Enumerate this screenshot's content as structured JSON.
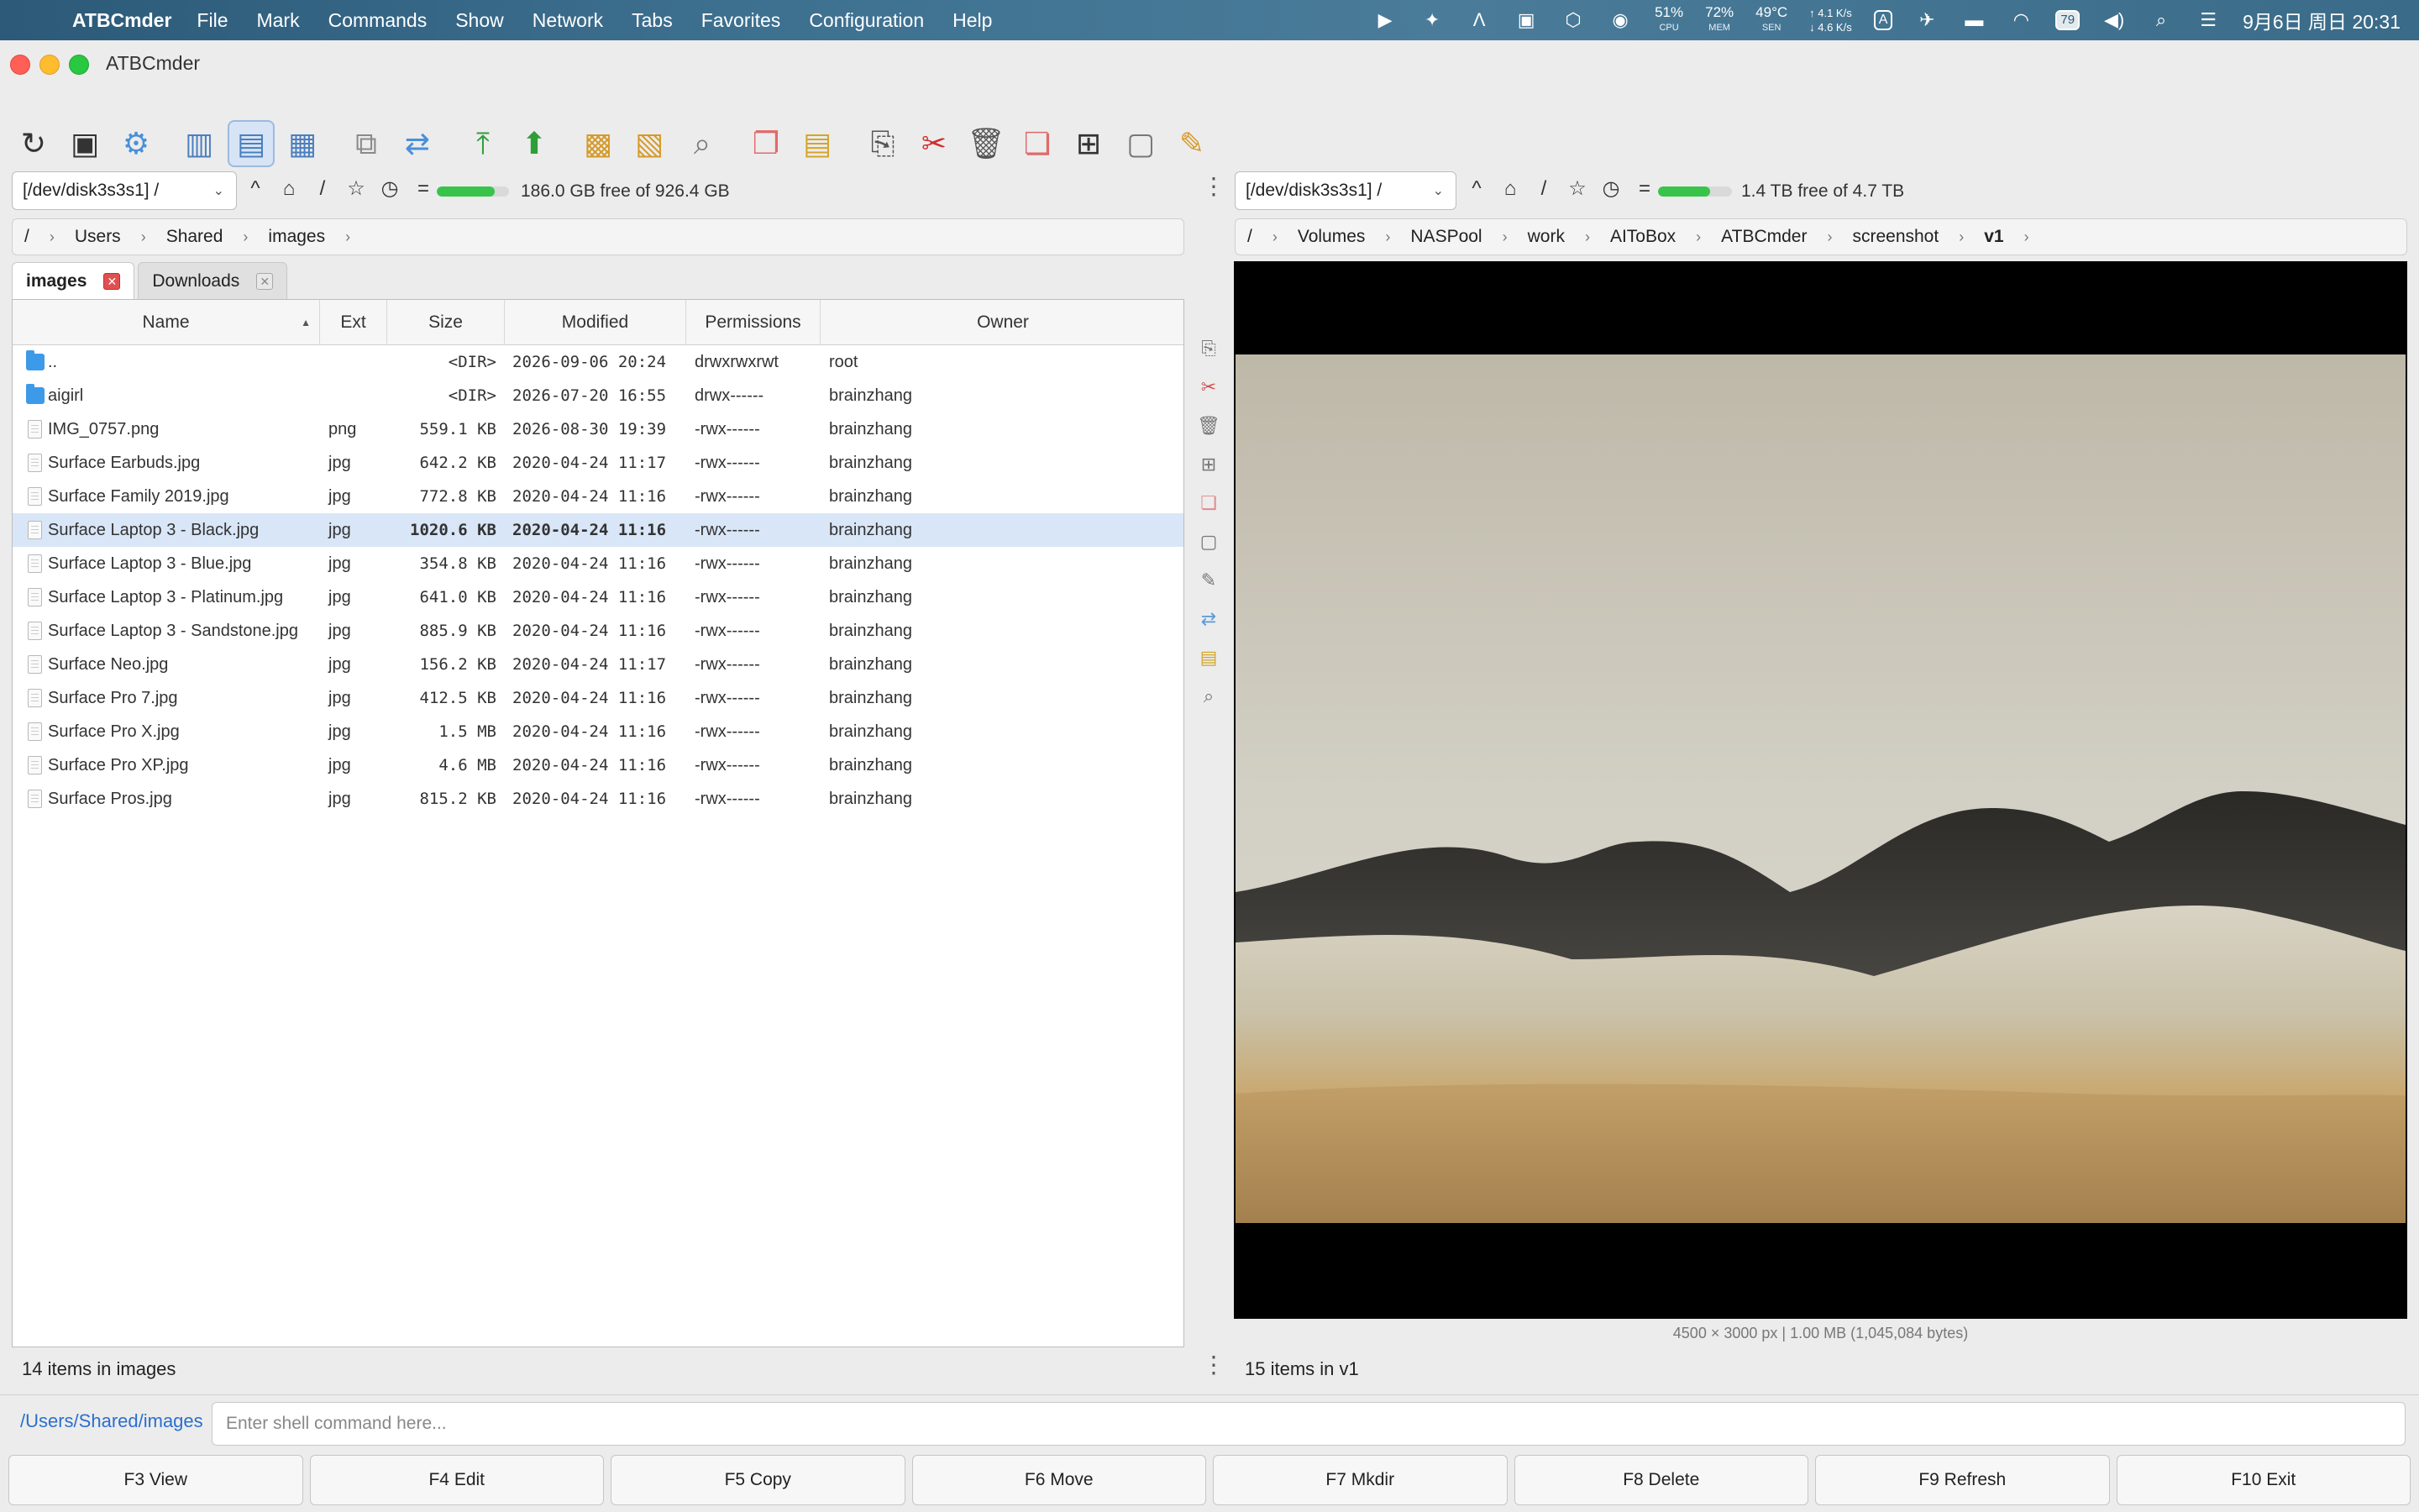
{
  "menubar": {
    "app_name": "ATBCmder",
    "items": [
      "File",
      "Mark",
      "Commands",
      "Show",
      "Network",
      "Tabs",
      "Favorites",
      "Configuration",
      "Help"
    ],
    "cpu": {
      "value": "51%",
      "label": "CPU"
    },
    "mem": {
      "value": "72%",
      "label": "MEM"
    },
    "sen": {
      "value": "49°C",
      "label": "SEN"
    },
    "net_up": "↑ 4.1 K/s",
    "net_down": "↓ 4.6 K/s",
    "input_method": "A",
    "battery": "79",
    "clock": "9月6日 周日 20:31"
  },
  "window": {
    "title": "ATBCmder"
  },
  "left_panel": {
    "drive": "[/dev/disk3s3s1] /",
    "free_space": "186.0 GB free of 926.4 GB",
    "used_fraction": 0.8,
    "breadcrumb": [
      "/",
      "Users",
      "Shared",
      "images"
    ],
    "tabs": [
      {
        "label": "images",
        "active": true
      },
      {
        "label": "Downloads",
        "active": false
      }
    ],
    "columns": [
      "Name",
      "Ext",
      "Size",
      "Modified",
      "Permissions",
      "Owner"
    ],
    "rows": [
      {
        "name": "..",
        "ext": "",
        "size": "<DIR>",
        "modified": "2026-09-06 20:24",
        "perm": "drwxrwxrwt",
        "owner": "root",
        "type": "folder"
      },
      {
        "name": "aigirl",
        "ext": "",
        "size": "<DIR>",
        "modified": "2026-07-20 16:55",
        "perm": "drwx------",
        "owner": "brainzhang",
        "type": "folder"
      },
      {
        "name": "IMG_0757.png",
        "ext": "png",
        "size": "559.1 KB",
        "modified": "2026-08-30 19:39",
        "perm": "-rwx------",
        "owner": "brainzhang",
        "type": "file"
      },
      {
        "name": "Surface Earbuds.jpg",
        "ext": "jpg",
        "size": "642.2 KB",
        "modified": "2020-04-24 11:17",
        "perm": "-rwx------",
        "owner": "brainzhang",
        "type": "file"
      },
      {
        "name": "Surface Family 2019.jpg",
        "ext": "jpg",
        "size": "772.8 KB",
        "modified": "2020-04-24 11:16",
        "perm": "-rwx------",
        "owner": "brainzhang",
        "type": "file"
      },
      {
        "name": "Surface Laptop 3 - Black.jpg",
        "ext": "jpg",
        "size": "1020.6 KB",
        "modified": "2020-04-24 11:16",
        "perm": "-rwx------",
        "owner": "brainzhang",
        "type": "file",
        "selected": true
      },
      {
        "name": "Surface Laptop 3 - Blue.jpg",
        "ext": "jpg",
        "size": "354.8 KB",
        "modified": "2020-04-24 11:16",
        "perm": "-rwx------",
        "owner": "brainzhang",
        "type": "file"
      },
      {
        "name": "Surface Laptop 3 - Platinum.jpg",
        "ext": "jpg",
        "size": "641.0 KB",
        "modified": "2020-04-24 11:16",
        "perm": "-rwx------",
        "owner": "brainzhang",
        "type": "file"
      },
      {
        "name": "Surface Laptop 3 - Sandstone.jpg",
        "ext": "jpg",
        "size": "885.9 KB",
        "modified": "2020-04-24 11:16",
        "perm": "-rwx------",
        "owner": "brainzhang",
        "type": "file"
      },
      {
        "name": "Surface Neo.jpg",
        "ext": "jpg",
        "size": "156.2 KB",
        "modified": "2020-04-24 11:17",
        "perm": "-rwx------",
        "owner": "brainzhang",
        "type": "file"
      },
      {
        "name": "Surface Pro 7.jpg",
        "ext": "jpg",
        "size": "412.5 KB",
        "modified": "2020-04-24 11:16",
        "perm": "-rwx------",
        "owner": "brainzhang",
        "type": "file"
      },
      {
        "name": "Surface Pro X.jpg",
        "ext": "jpg",
        "size": "1.5 MB",
        "modified": "2020-04-24 11:16",
        "perm": "-rwx------",
        "owner": "brainzhang",
        "type": "file"
      },
      {
        "name": "Surface Pro XP.jpg",
        "ext": "jpg",
        "size": "4.6 MB",
        "modified": "2020-04-24 11:16",
        "perm": "-rwx------",
        "owner": "brainzhang",
        "type": "file"
      },
      {
        "name": "Surface Pros.jpg",
        "ext": "jpg",
        "size": "815.2 KB",
        "modified": "2020-04-24 11:16",
        "perm": "-rwx------",
        "owner": "brainzhang",
        "type": "file"
      }
    ],
    "status": "14 items in images"
  },
  "right_panel": {
    "drive": "[/dev/disk3s3s1] /",
    "free_space": "1.4 TB free of 4.7 TB",
    "used_fraction": 0.7,
    "breadcrumb": [
      "/",
      "Volumes",
      "NASPool",
      "work",
      "AIToBox",
      "ATBCmder",
      "screenshot",
      "v1"
    ],
    "image_info": "4500 × 3000 px | 1.00 MB (1,045,084 bytes)",
    "status": "15 items in v1"
  },
  "command_line": {
    "path": "/Users/Shared/images",
    "placeholder": "Enter shell command here..."
  },
  "function_keys": [
    "F3 View",
    "F4 Edit",
    "F5 Copy",
    "F6 Move",
    "F7 Mkdir",
    "F8 Delete",
    "F9 Refresh",
    "F10 Exit"
  ]
}
